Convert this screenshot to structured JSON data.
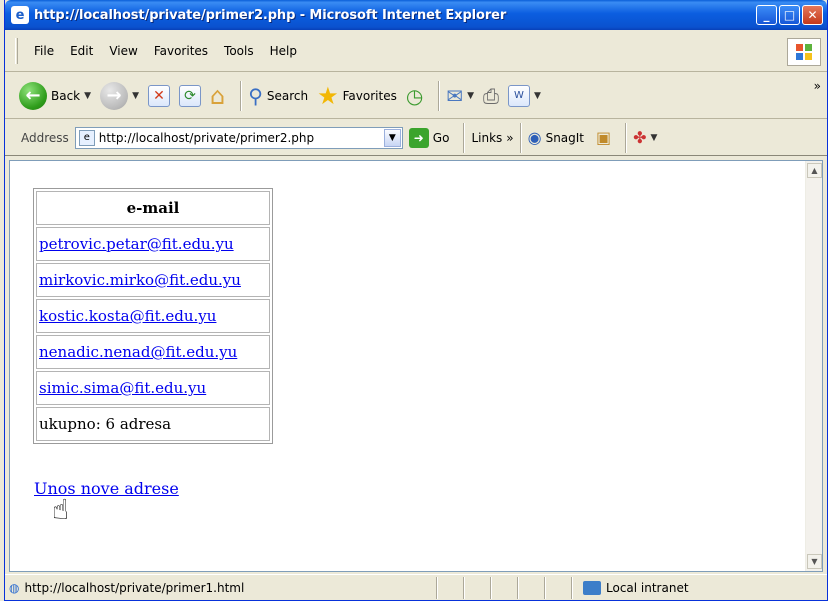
{
  "window": {
    "title": "http://localhost/private/primer2.php - Microsoft Internet Explorer",
    "minimize": "_",
    "maximize": "□",
    "close": "✕"
  },
  "menu": [
    "File",
    "Edit",
    "View",
    "Favorites",
    "Tools",
    "Help"
  ],
  "toolbar": {
    "back_label": "Back",
    "search_label": "Search",
    "favorites_label": "Favorites"
  },
  "address": {
    "label": "Address",
    "url": "http://localhost/private/primer2.php",
    "go_label": "Go",
    "links_label": "Links",
    "snagit_label": "SnagIt"
  },
  "table": {
    "header": "e-mail",
    "emails": [
      "petrovic.petar@fit.edu.yu",
      "mirkovic.mirko@fit.edu.yu",
      "kostic.kosta@fit.edu.yu",
      "nenadic.nenad@fit.edu.yu",
      "simic.sima@fit.edu.yu"
    ],
    "total": "ukupno: 6 adresa"
  },
  "new_address_link": "Unos nove adrese",
  "status": {
    "url": "http://localhost/private/primer1.html",
    "zone": "Local intranet"
  },
  "colors": {
    "titlebar": "#0a52cf",
    "link": "#0000ee",
    "chrome": "#ece9d8"
  }
}
